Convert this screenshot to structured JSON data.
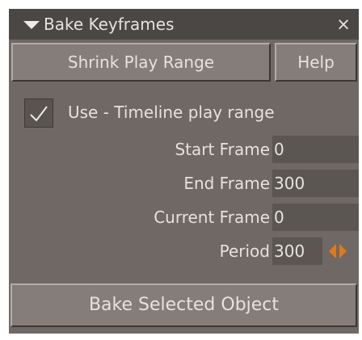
{
  "window": {
    "title": "Bake Keyframes",
    "collapse_icon": "triangle-down-icon",
    "close_label": "×"
  },
  "buttons": {
    "shrink_label": "Shrink Play Range",
    "help_label": "Help",
    "bake_label": "Bake Selected Object"
  },
  "use_timeline": {
    "checked": true,
    "label": "Use - Timeline play range"
  },
  "fields": [
    {
      "label": "Start Frame",
      "value": "0"
    },
    {
      "label": "End Frame",
      "value": "300"
    },
    {
      "label": "Current Frame",
      "value": "0"
    },
    {
      "label": "Period",
      "value": "300"
    }
  ],
  "period_spinner_icon": "left-right-arrows-icon",
  "colors": {
    "panel_bg": "#6f6864",
    "titlebar_bg": "#4a4744",
    "field_bg": "#5c5653",
    "spinner_accent": "#e07a1a"
  }
}
